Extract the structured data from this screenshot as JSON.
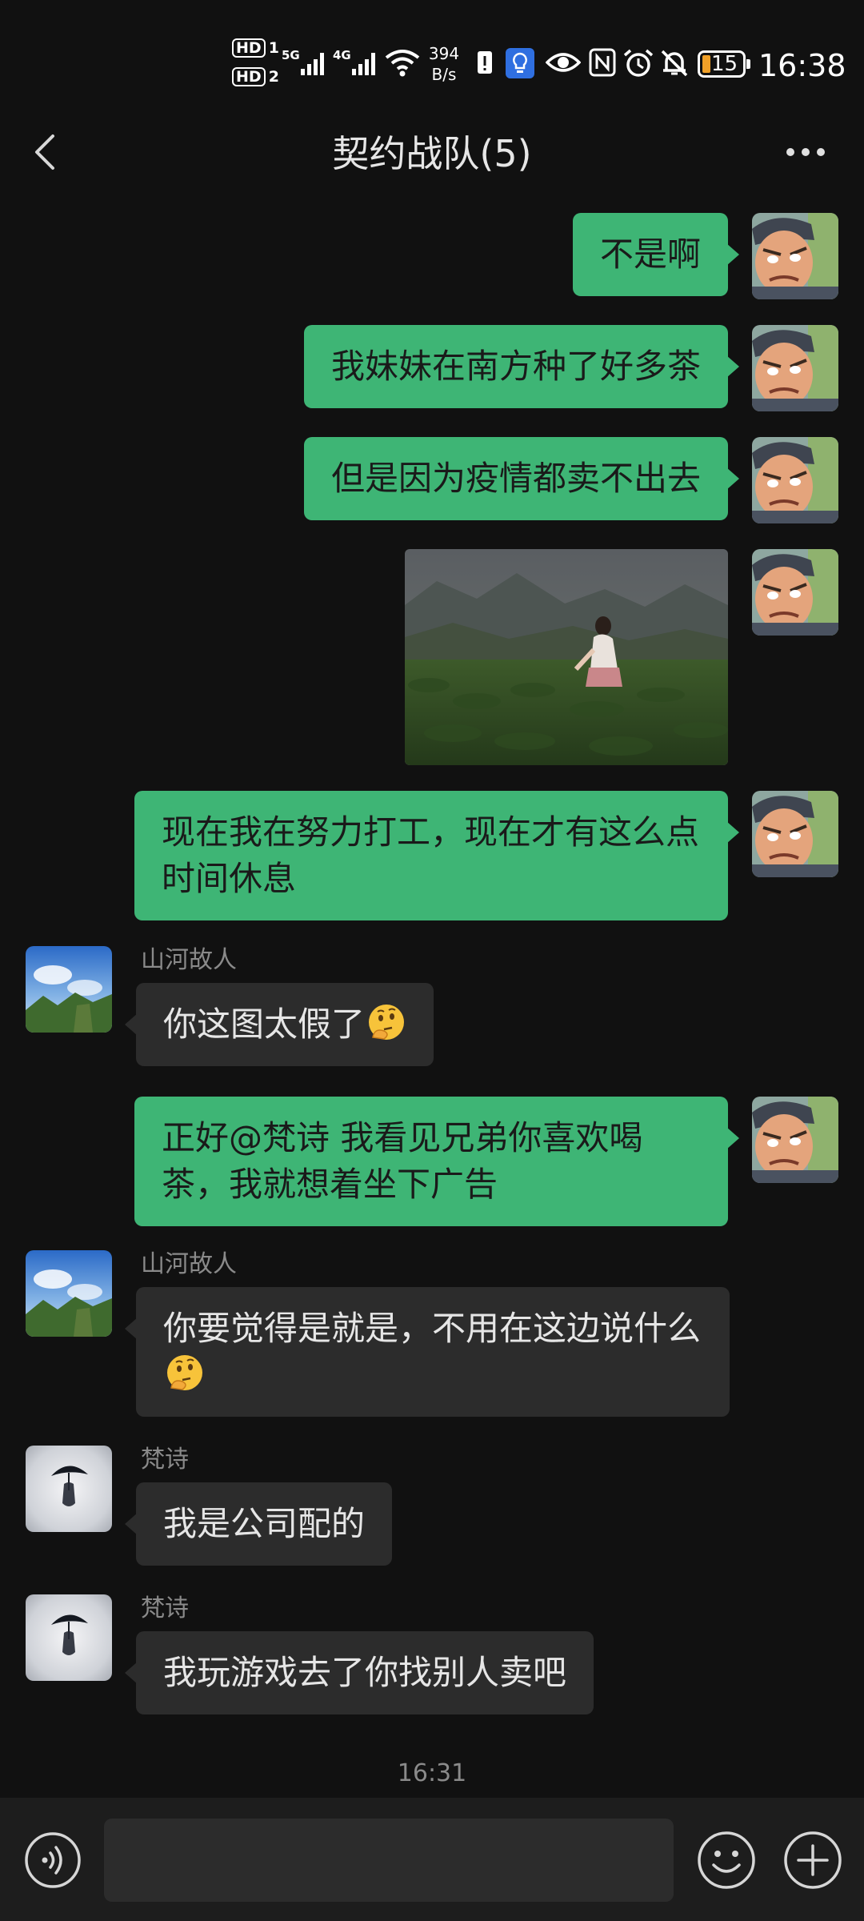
{
  "status_bar": {
    "hd1": "HD",
    "hd1_num": "1",
    "hd2": "HD",
    "hd2_num": "2",
    "net1": "5G",
    "net2": "4G",
    "speed_value": "394",
    "speed_unit": "B/s",
    "battery": "15",
    "time": "16:38"
  },
  "header": {
    "title": "契约战队(5)"
  },
  "messages": [
    {
      "from": "me",
      "text": "不是啊"
    },
    {
      "from": "me",
      "text": "我妹妹在南方种了好多茶"
    },
    {
      "from": "me",
      "text": "但是因为疫情都卖不出去"
    },
    {
      "from": "me",
      "type": "image",
      "icon": "tea-field-photo"
    },
    {
      "from": "me",
      "text": "现在我在努力打工，现在才有这么点时间休息"
    },
    {
      "from": "them",
      "sender": "山河故人",
      "text": "你这图太假了",
      "emoji": "thinking-face-icon"
    },
    {
      "from": "me",
      "text": "正好@梵诗  我看见兄弟你喜欢喝茶，我就想着坐下广告"
    },
    {
      "from": "them",
      "sender": "山河故人",
      "text": "你要觉得是就是，不用在这边说什么",
      "emoji": "thinking-face-icon"
    },
    {
      "from": "them",
      "sender": "梵诗",
      "text": "我是公司配的"
    },
    {
      "from": "them",
      "sender": "梵诗",
      "text": "我玩游戏去了你找别人卖吧"
    }
  ],
  "timestamp": "16:31",
  "input": {
    "value": "",
    "placeholder": ""
  },
  "colors": {
    "background": "#111111",
    "my_bubble": "#3eb575",
    "their_bubble": "#2c2c2c",
    "input_bar": "#1d1d1d"
  }
}
